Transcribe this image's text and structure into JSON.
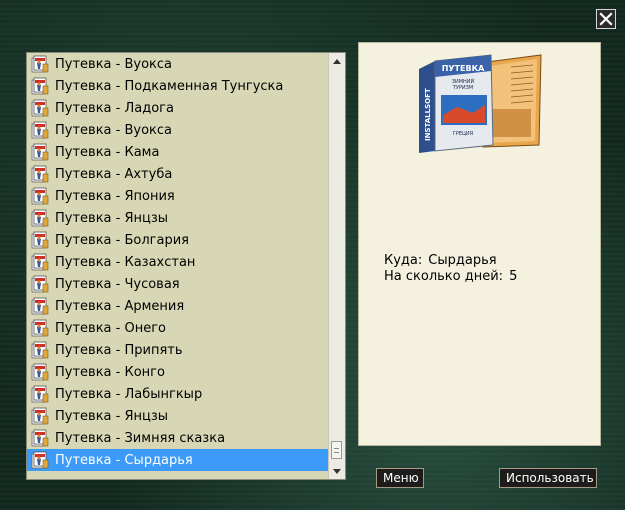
{
  "window": {
    "close_icon": "close-icon"
  },
  "list": {
    "icon": "travel-ticket-icon",
    "selected_index": 18,
    "items": [
      "Путевка - Вуокса",
      "Путевка - Подкаменная Тунгуска",
      "Путевка - Ладога",
      "Путевка - Вуокса",
      "Путевка - Кама",
      "Путевка - Ахтуба",
      "Путевка - Япония",
      "Путевка - Янцзы",
      "Путевка - Болгария",
      "Путевка - Казахстан",
      "Путевка - Чусовая",
      "Путевка - Армения",
      "Путевка - Онего",
      "Путевка - Припять",
      "Путевка - Конго",
      "Путевка - Лабынгкыр",
      "Путевка - Янцзы",
      "Путевка - Зимняя сказка",
      "Путевка - Сырдарья"
    ]
  },
  "detail": {
    "image": {
      "brand": "INSTALLSOFT",
      "title": "ПУТЕВКА",
      "subtitle1": "ЗИМНИЙ",
      "subtitle2": "ТУРИЗМ",
      "subtitle3": "ГРЕЦИЯ"
    },
    "destination_label": "Куда:",
    "destination_value": "Сырдарья",
    "days_label": "На сколько дней:",
    "days_value": "5"
  },
  "buttons": {
    "menu_label": "Меню",
    "use_label": "Использовать"
  },
  "colors": {
    "list_bg": "#d8d7b5",
    "selected_bg": "#3c9af8",
    "detail_bg": "#f4f2df",
    "button_bg": "#1e1c1a"
  }
}
